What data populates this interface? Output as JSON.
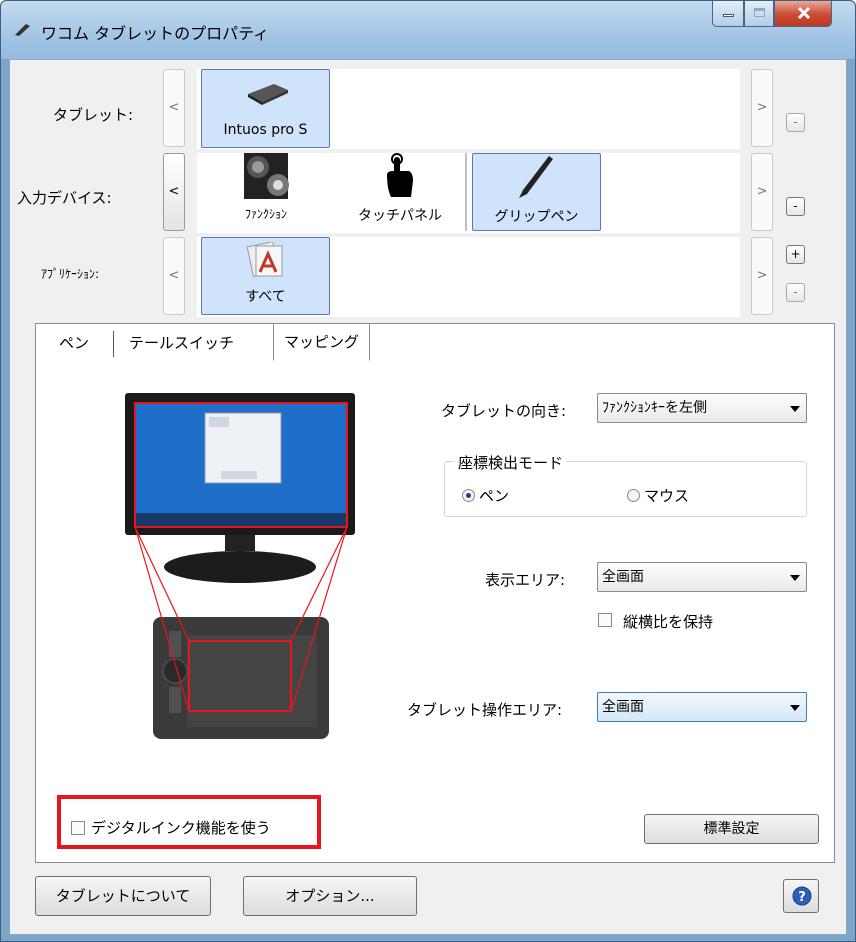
{
  "window": {
    "title": "ワコム タブレットのプロパティ"
  },
  "rows": {
    "tablet": {
      "label": "タブレット:",
      "nav_prev": "<",
      "nav_next": ">",
      "remove": "-",
      "items": [
        {
          "label": "Intuos pro S",
          "icon": "tablet-icon",
          "selected": true
        }
      ]
    },
    "input_device": {
      "label": "入力デバイス:",
      "nav_prev": "<",
      "nav_next": ">",
      "remove": "-",
      "items": [
        {
          "label": "ﾌｧﾝｸｼｮﾝ",
          "icon": "function-keys-icon",
          "selected": false
        },
        {
          "label": "タッチパネル",
          "icon": "touch-hand-icon",
          "selected": false
        },
        {
          "label": "グリップペン",
          "icon": "grip-pen-icon",
          "selected": true
        }
      ]
    },
    "application": {
      "label": "ｱﾌﾟﾘｹｰｼｮﾝ:",
      "nav_prev": "<",
      "nav_next": ">",
      "add": "+",
      "remove": "-",
      "items": [
        {
          "label": "すべて",
          "icon": "all-apps-icon",
          "selected": true
        }
      ]
    }
  },
  "tabs": [
    {
      "label": "ペン",
      "selected": false
    },
    {
      "label": "テールスイッチ",
      "selected": false
    },
    {
      "label": "マッピング",
      "selected": true
    }
  ],
  "mapping": {
    "orientation": {
      "label": "タブレットの向き:",
      "value": "ﾌｧﾝｸｼｮﾝｷｰを左側"
    },
    "mode_group": {
      "title": "座標検出モード",
      "options": [
        {
          "label": "ペン",
          "checked": true
        },
        {
          "label": "マウス",
          "checked": false
        }
      ]
    },
    "display_area": {
      "label": "表示エリア:",
      "value": "全画面"
    },
    "keep_aspect": {
      "label": "縦横比を保持",
      "checked": false
    },
    "tablet_area": {
      "label": "タブレット操作エリア:",
      "value": "全画面"
    },
    "digital_ink": {
      "label": "デジタルインク機能を使う",
      "checked": false
    },
    "default_button": "標準設定"
  },
  "footer": {
    "about_button": "タブレットについて",
    "options_button": "オプション...",
    "help_icon": "help-icon"
  },
  "colors": {
    "highlight_box": "#e8151c",
    "selection": "#cfe3fb",
    "titlebar": "#a3c5e4"
  }
}
